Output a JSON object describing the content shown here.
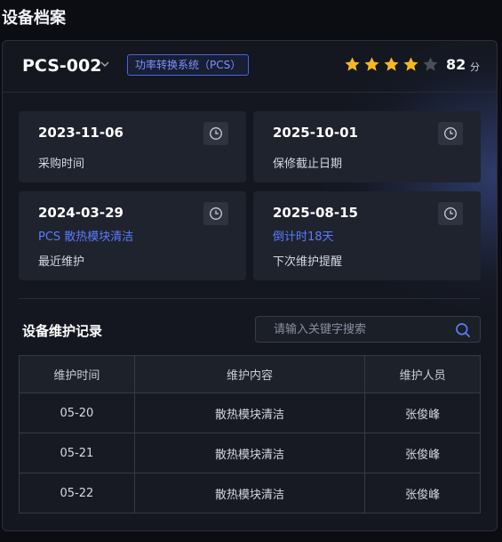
{
  "page": {
    "title": "设备档案"
  },
  "device": {
    "name": "PCS-002",
    "type_badge": "功率转换系统（PCS）",
    "rating": {
      "stars_filled": 4,
      "stars_total": 5,
      "score": "82",
      "unit": "分"
    }
  },
  "cards": [
    {
      "date": "2023-11-06",
      "sub": "",
      "label": "采购时间"
    },
    {
      "date": "2025-10-01",
      "sub": "",
      "label": "保修截止日期"
    },
    {
      "date": "2024-03-29",
      "sub": "PCS 散热模块清洁",
      "label": "最近维护"
    },
    {
      "date": "2025-08-15",
      "sub": "倒计时18天",
      "label": "下次维护提醒"
    }
  ],
  "records": {
    "title": "设备维护记录",
    "search_placeholder": "请输入关键字搜索",
    "columns": [
      "维护时间",
      "维护内容",
      "维护人员"
    ],
    "rows": [
      [
        "05-20",
        "散热模块清洁",
        "张俊峰"
      ],
      [
        "05-21",
        "散热模块清洁",
        "张俊峰"
      ],
      [
        "05-22",
        "散热模块清洁",
        "张俊峰"
      ]
    ]
  },
  "colors": {
    "accent": "#5b7bff",
    "star_filled": "#f5b920",
    "star_empty": "#4a4e58",
    "background": "#0b0d12"
  },
  "icons": [
    "chevron-down-icon",
    "star-icon",
    "clock-icon",
    "search-icon"
  ]
}
